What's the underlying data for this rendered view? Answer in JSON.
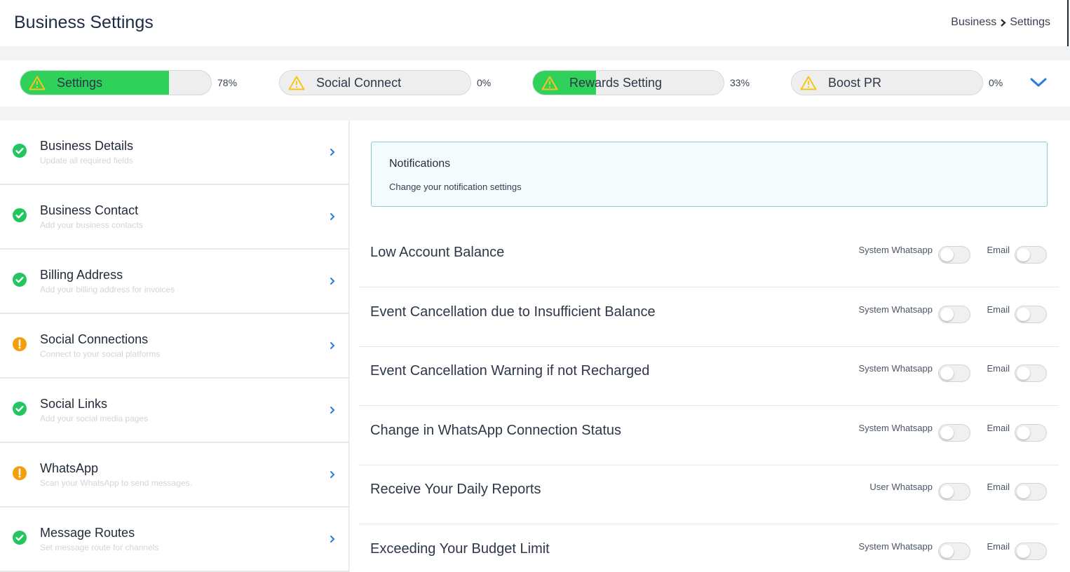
{
  "header": {
    "title": "Business Settings",
    "breadcrumb": [
      "Business",
      "Settings"
    ]
  },
  "progress": [
    {
      "label": "Settings",
      "percent": 78,
      "percent_label": "78%",
      "status": "warning"
    },
    {
      "label": "Social Connect",
      "percent": 0,
      "percent_label": "0%",
      "status": "warning"
    },
    {
      "label": "Rewards Setting",
      "percent": 33,
      "percent_label": "33%",
      "status": "warning"
    },
    {
      "label": "Boost PR",
      "percent": 0,
      "percent_label": "0%",
      "status": "warning"
    }
  ],
  "sidebar": {
    "items": [
      {
        "title": "Business Details",
        "subtitle": "Update all required fields",
        "status": "complete"
      },
      {
        "title": "Business Contact",
        "subtitle": "Add your business contacts",
        "status": "complete"
      },
      {
        "title": "Billing Address",
        "subtitle": "Add your billing address for invoices",
        "status": "complete"
      },
      {
        "title": "Social Connections",
        "subtitle": "Connect to your social platforms",
        "status": "warning"
      },
      {
        "title": "Social Links",
        "subtitle": "Add your social media pages",
        "status": "complete"
      },
      {
        "title": "WhatsApp",
        "subtitle": "Scan your WhatsApp to send messages.",
        "status": "warning"
      },
      {
        "title": "Message Routes",
        "subtitle": "Set message route for channels",
        "status": "complete"
      }
    ]
  },
  "notice": {
    "title": "Notifications",
    "subtitle": "Change your notification settings"
  },
  "notifications": [
    {
      "title": "Low Account Balance",
      "channel1": "System Whatsapp",
      "channel1_on": false,
      "channel2": "Email",
      "channel2_on": false
    },
    {
      "title": "Event Cancellation due to Insufficient Balance",
      "channel1": "System Whatsapp",
      "channel1_on": false,
      "channel2": "Email",
      "channel2_on": false
    },
    {
      "title": "Event Cancellation Warning if not Recharged",
      "channel1": "System Whatsapp",
      "channel1_on": false,
      "channel2": "Email",
      "channel2_on": false
    },
    {
      "title": "Change in WhatsApp Connection Status",
      "channel1": "System Whatsapp",
      "channel1_on": false,
      "channel2": "Email",
      "channel2_on": false
    },
    {
      "title": "Receive Your Daily Reports",
      "channel1": "User Whatsapp",
      "channel1_on": false,
      "channel2": "Email",
      "channel2_on": false
    },
    {
      "title": "Exceeding Your Budget Limit",
      "channel1": "System Whatsapp",
      "channel1_on": false,
      "channel2": "Email",
      "channel2_on": false
    }
  ],
  "colors": {
    "progress_fill": "#2fd15a",
    "complete": "#22c55e",
    "warning_sidebar": "#f59e0b",
    "warning_triangle": "#f5c518",
    "accent_chevron": "#2b7bd9",
    "notice_border": "#8ccad6"
  },
  "icons": {
    "progress_status": "warning-triangle-icon",
    "sidebar_complete": "check-circle-icon",
    "sidebar_warning": "exclamation-circle-icon",
    "sidebar_arrow": "chevron-right-icon",
    "expand": "chevron-down-icon",
    "breadcrumb_sep": "chevron-right-icon"
  }
}
